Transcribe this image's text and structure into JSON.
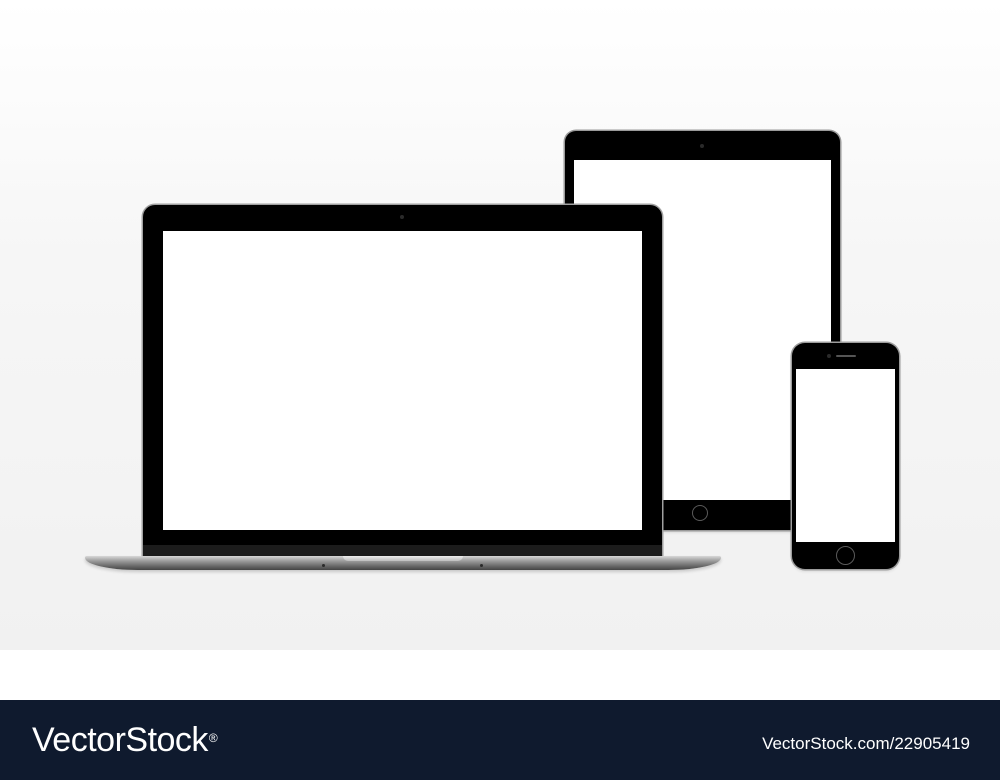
{
  "footer": {
    "brand_name": "VectorStock",
    "brand_mark": "®",
    "image_id": "VectorStock.com/22905419",
    "background_color": "#0f1a2e"
  },
  "devices": {
    "laptop": {
      "screen_color": "#ffffff",
      "bezel_color": "#000000"
    },
    "tablet": {
      "screen_color": "#ffffff",
      "bezel_color": "#000000"
    },
    "phone": {
      "screen_color": "#ffffff",
      "bezel_color": "#000000"
    }
  },
  "background_color": "#f3f3f3"
}
